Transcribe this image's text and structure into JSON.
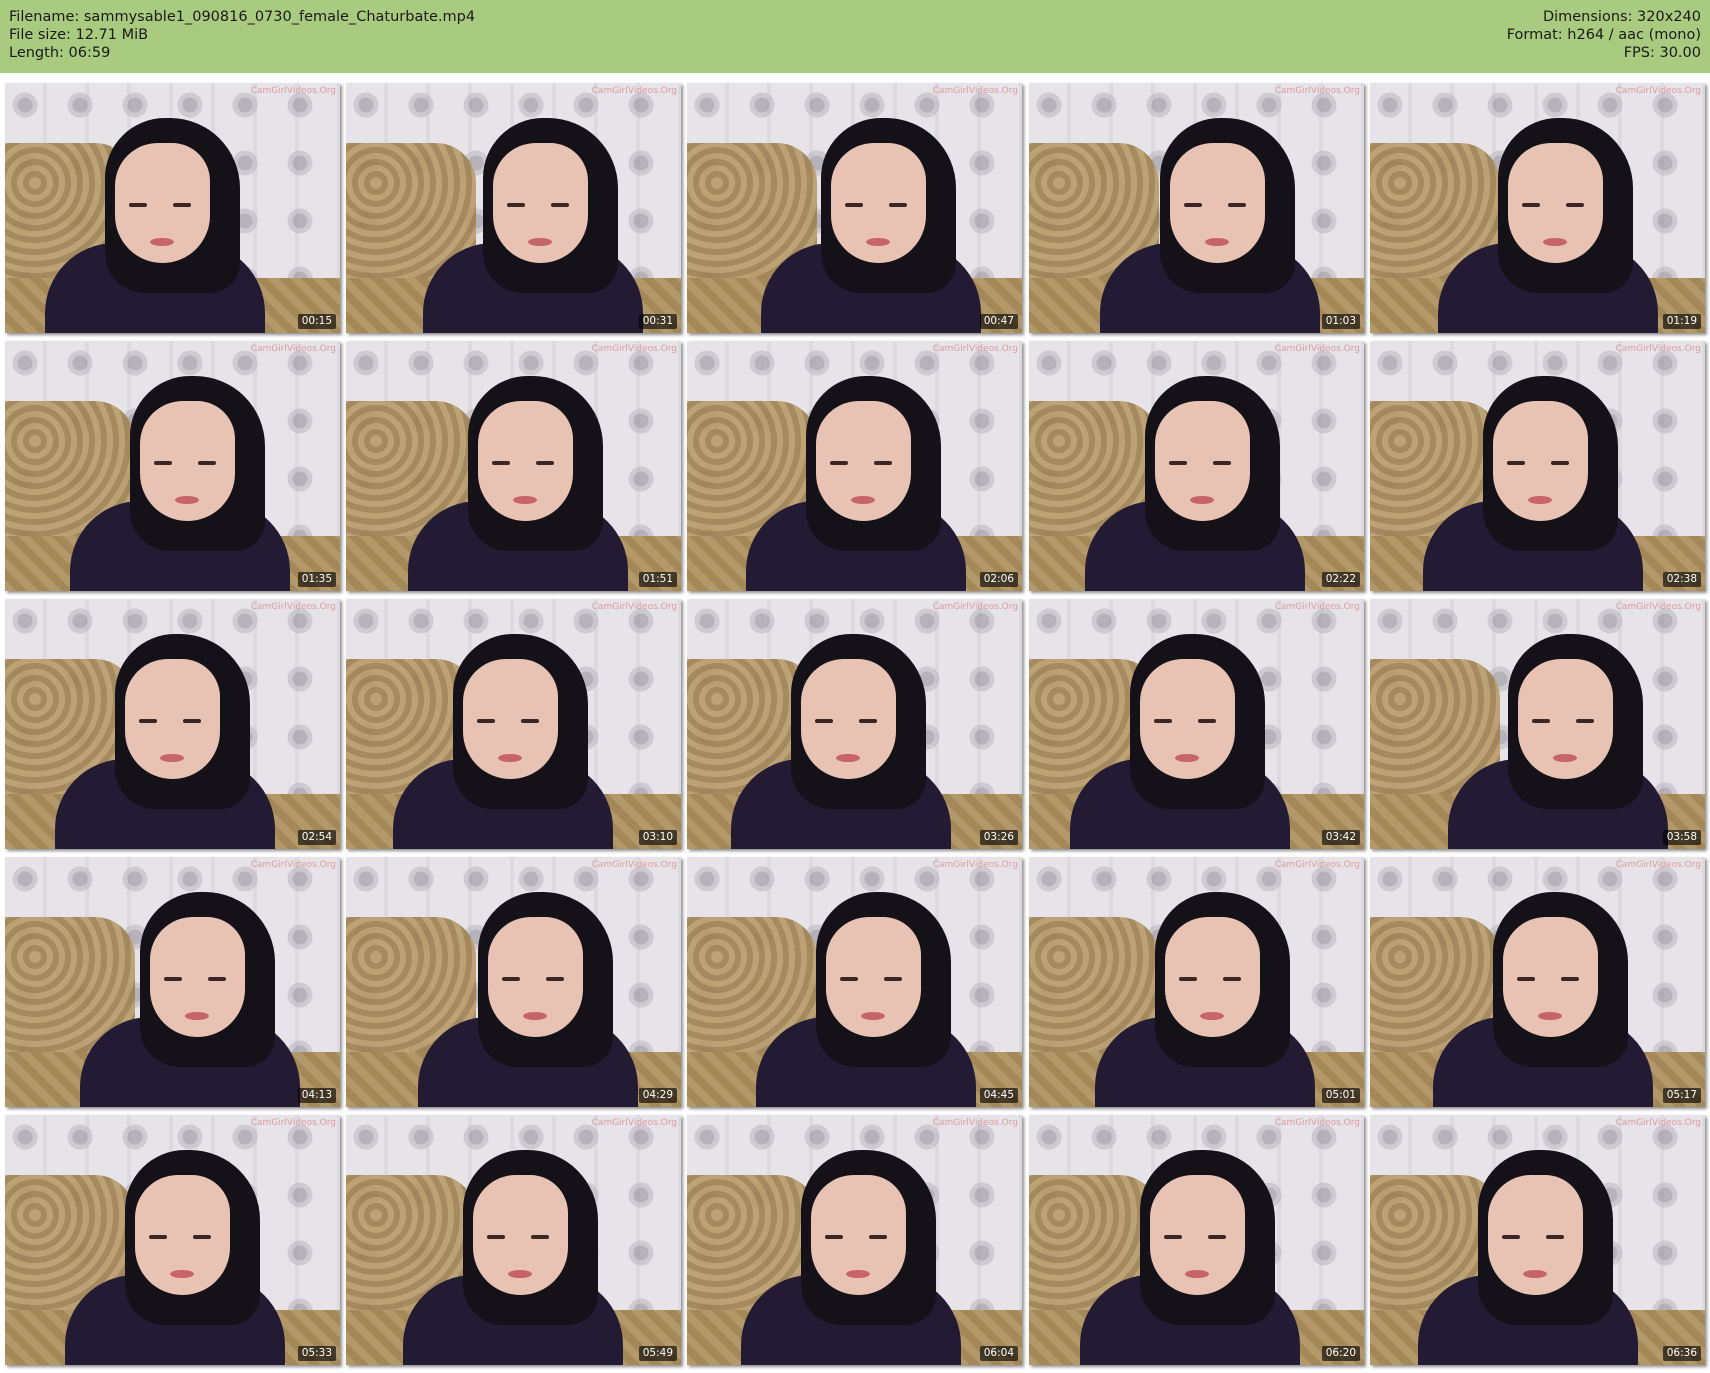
{
  "header": {
    "filename_line": "Filename: sammysable1_090816_0730_female_Chaturbate.mp4",
    "filesize_line": "File size: 12.71 MiB",
    "length_line": "Length: 06:59",
    "dimensions_line": "Dimensions: 320x240",
    "format_line": "Format: h264 / aac (mono)",
    "fps_line": "FPS: 30.00"
  },
  "colors": {
    "header_bg": "#a9cb7f",
    "page_bg": "#ffffff"
  },
  "grid": {
    "columns": 5,
    "rows": 5
  },
  "watermark_text": "CamGirlVideos.Org",
  "thumbnails": [
    {
      "timestamp": "00:15"
    },
    {
      "timestamp": "00:31"
    },
    {
      "timestamp": "00:47"
    },
    {
      "timestamp": "01:03"
    },
    {
      "timestamp": "01:19"
    },
    {
      "timestamp": "01:35"
    },
    {
      "timestamp": "01:51"
    },
    {
      "timestamp": "02:06"
    },
    {
      "timestamp": "02:22"
    },
    {
      "timestamp": "02:38"
    },
    {
      "timestamp": "02:54"
    },
    {
      "timestamp": "03:10"
    },
    {
      "timestamp": "03:26"
    },
    {
      "timestamp": "03:42"
    },
    {
      "timestamp": "03:58"
    },
    {
      "timestamp": "04:13"
    },
    {
      "timestamp": "04:29"
    },
    {
      "timestamp": "04:45"
    },
    {
      "timestamp": "05:01"
    },
    {
      "timestamp": "05:17"
    },
    {
      "timestamp": "05:33"
    },
    {
      "timestamp": "05:49"
    },
    {
      "timestamp": "06:04"
    },
    {
      "timestamp": "06:20"
    },
    {
      "timestamp": "06:36"
    }
  ]
}
